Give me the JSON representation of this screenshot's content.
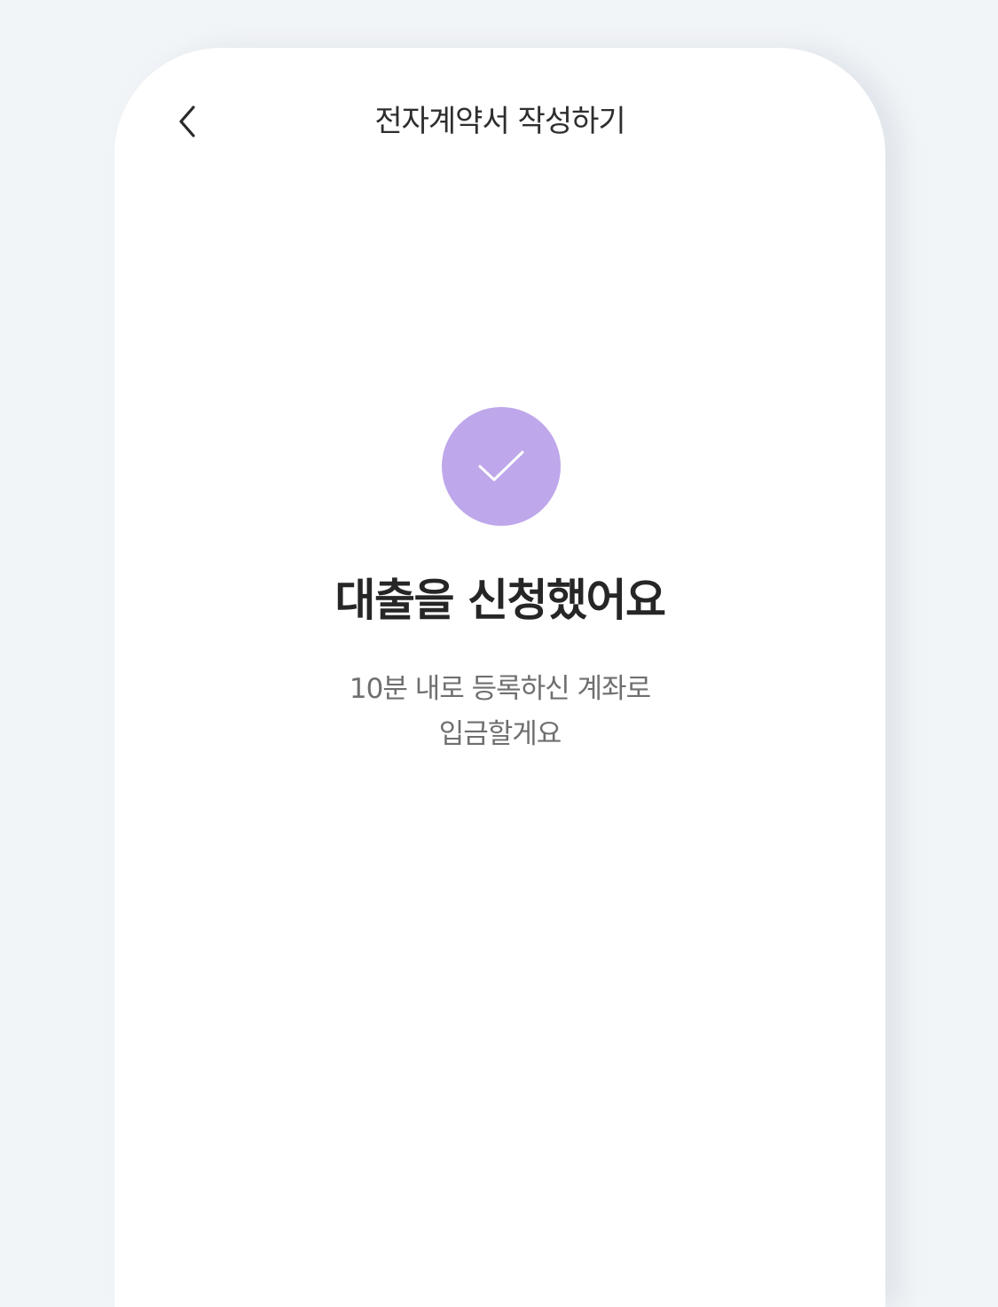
{
  "header": {
    "title": "전자계약서 작성하기",
    "back_icon": "chevron-left-icon"
  },
  "status": {
    "icon": "check-icon",
    "circle_color": "#bea7ea",
    "title": "대출을 신청했어요",
    "description_line1": "10분 내로 등록하신 계좌로",
    "description_line2": "입금할게요"
  }
}
